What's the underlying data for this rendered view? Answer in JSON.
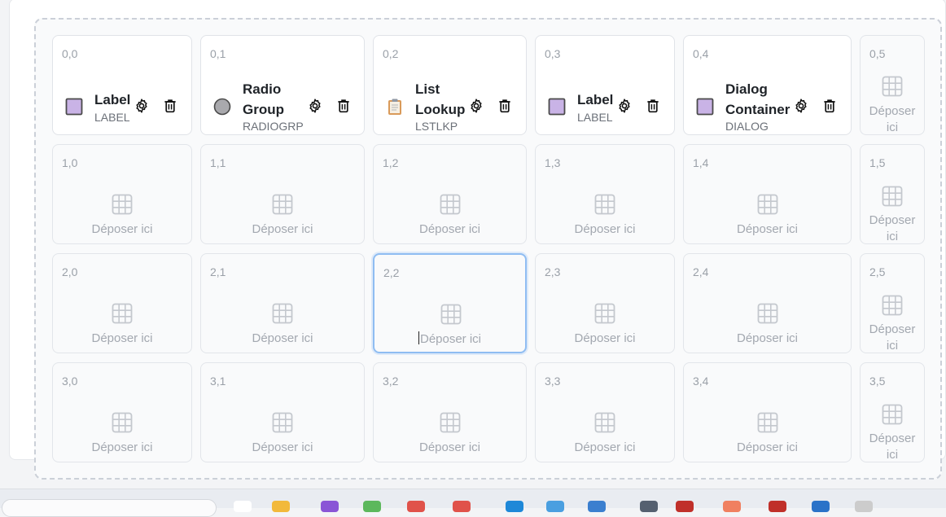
{
  "grid": {
    "drop_label": "Déposer ici",
    "rows": [
      [
        {
          "coord": "0,0",
          "type": "filled",
          "name": [
            "Label"
          ],
          "code": "LABEL",
          "icon": "label-square-icon"
        },
        {
          "coord": "0,1",
          "type": "filled",
          "name": [
            "Radio",
            "Group"
          ],
          "code": "RADIOGRP",
          "icon": "radio-circle-icon"
        },
        {
          "coord": "0,2",
          "type": "filled",
          "name": [
            "List",
            "Lookup"
          ],
          "code": "LSTLKP",
          "icon": "clipboard-icon"
        },
        {
          "coord": "0,3",
          "type": "filled",
          "name": [
            "Label"
          ],
          "code": "LABEL",
          "icon": "label-square-icon"
        },
        {
          "coord": "0,4",
          "type": "filled",
          "name": [
            "Dialog",
            "Container"
          ],
          "code": "DIALOG",
          "icon": "dialog-square-icon"
        },
        {
          "coord": "0,5",
          "type": "empty",
          "drop": [
            "Déposer",
            "ici"
          ]
        }
      ],
      [
        {
          "coord": "1,0",
          "type": "empty"
        },
        {
          "coord": "1,1",
          "type": "empty"
        },
        {
          "coord": "1,2",
          "type": "empty"
        },
        {
          "coord": "1,3",
          "type": "empty"
        },
        {
          "coord": "1,4",
          "type": "empty"
        },
        {
          "coord": "1,5",
          "type": "empty",
          "drop": [
            "Déposer",
            "ici"
          ]
        }
      ],
      [
        {
          "coord": "2,0",
          "type": "empty"
        },
        {
          "coord": "2,1",
          "type": "empty"
        },
        {
          "coord": "2,2",
          "type": "empty",
          "selected": true
        },
        {
          "coord": "2,3",
          "type": "empty"
        },
        {
          "coord": "2,4",
          "type": "empty"
        },
        {
          "coord": "2,5",
          "type": "empty",
          "drop": [
            "Déposer",
            "ici"
          ]
        }
      ],
      [
        {
          "coord": "3,0",
          "type": "empty"
        },
        {
          "coord": "3,1",
          "type": "empty"
        },
        {
          "coord": "3,2",
          "type": "empty"
        },
        {
          "coord": "3,3",
          "type": "empty"
        },
        {
          "coord": "3,4",
          "type": "empty"
        },
        {
          "coord": "3,5",
          "type": "empty",
          "drop": [
            "Déposer",
            "ici"
          ]
        }
      ]
    ]
  },
  "colors": {
    "label_square_fill": "#c9b3e6",
    "label_square_border": "#4a4a4a",
    "selected_border": "#8fbdf2",
    "muted_text": "#a3a8b0"
  },
  "taskbar": {
    "icons": [
      "file-icon",
      "folder-icon",
      "app-icon",
      "app-icon",
      "app-icon",
      "app-icon",
      "app-icon",
      "app-icon",
      "app-icon",
      "app-icon",
      "app-icon",
      "app-icon",
      "app-icon",
      "app-icon",
      "app-icon",
      "app-icon"
    ]
  }
}
